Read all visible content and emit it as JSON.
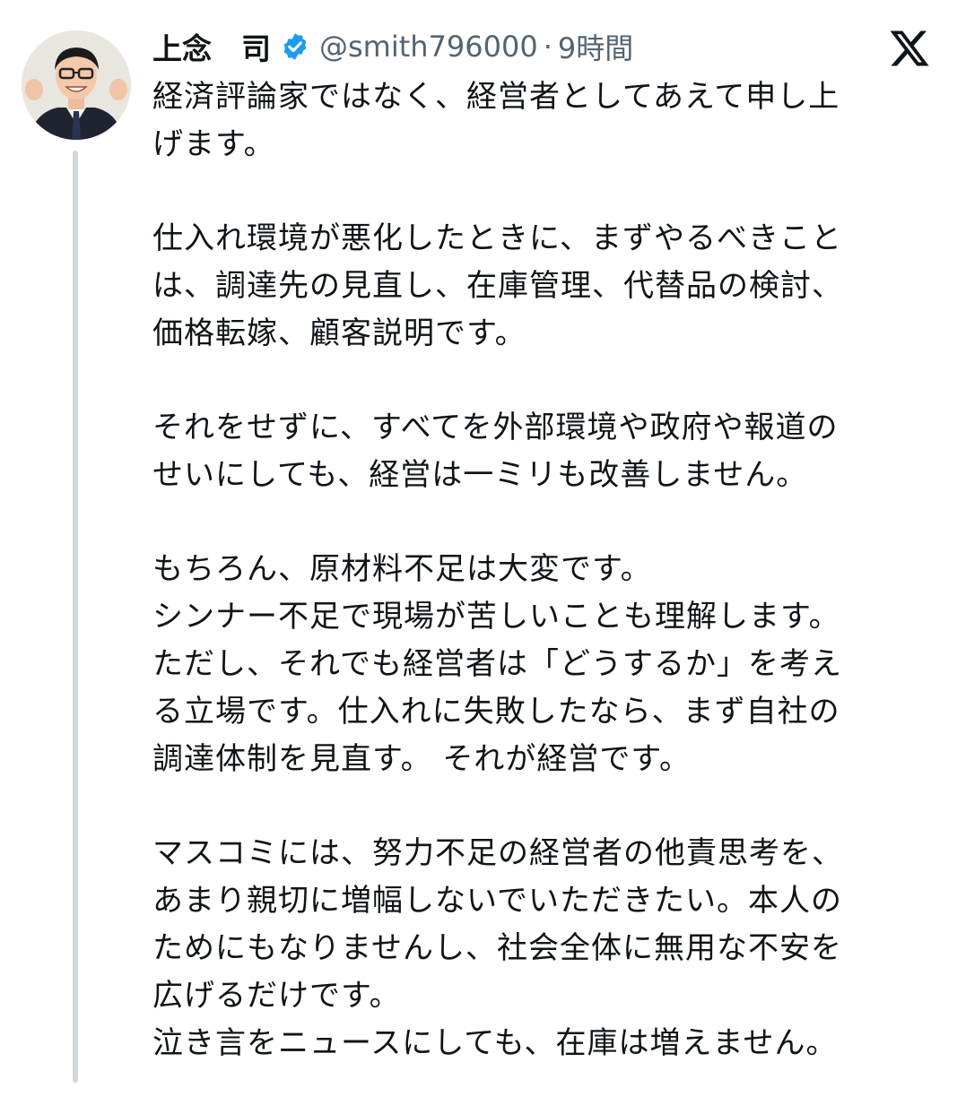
{
  "author": {
    "name": "上念　司",
    "handle": "@smith796000",
    "separator": "·",
    "time": "9時間"
  },
  "icons": {
    "avatar": "profile-photo",
    "verified": "verified-badge-icon",
    "platform": "x-logo-icon"
  },
  "colors": {
    "verified_blue": "#1d9bf0",
    "secondary_text": "#536471",
    "thread_line": "#cfd9de"
  },
  "tweet": {
    "paragraphs": [
      {
        "lines": [
          "経済評論家ではなく、経営者としてあえて申し上",
          "げます。"
        ]
      },
      {
        "lines": [
          "仕入れ環境が悪化したときに、まずやるべきこと",
          "は、調達先の見直し、在庫管理、代替品の検討、",
          "価格転嫁、顧客説明です。"
        ]
      },
      {
        "lines": [
          "それをせずに、すべてを外部環境や政府や報道の",
          "せいにしても、経営は一ミリも改善しません。"
        ]
      },
      {
        "lines": [
          "もちろん、原材料不足は大変です。",
          "シンナー不足で現場が苦しいことも理解します。",
          "ただし、それでも経営者は「どうするか」を考え",
          "る立場です。仕入れに失敗したなら、まず自社の",
          "調達体制を見直す。 それが経営です。"
        ]
      },
      {
        "lines": [
          "マスコミには、努力不足の経営者の他責思考を、",
          "あまり親切に増幅しないでいただきたい。本人の",
          "ためにもなりませんし、社会全体に無用な不安を",
          "広げるだけです。",
          "泣き言をニュースにしても、在庫は増えません。"
        ]
      }
    ]
  }
}
